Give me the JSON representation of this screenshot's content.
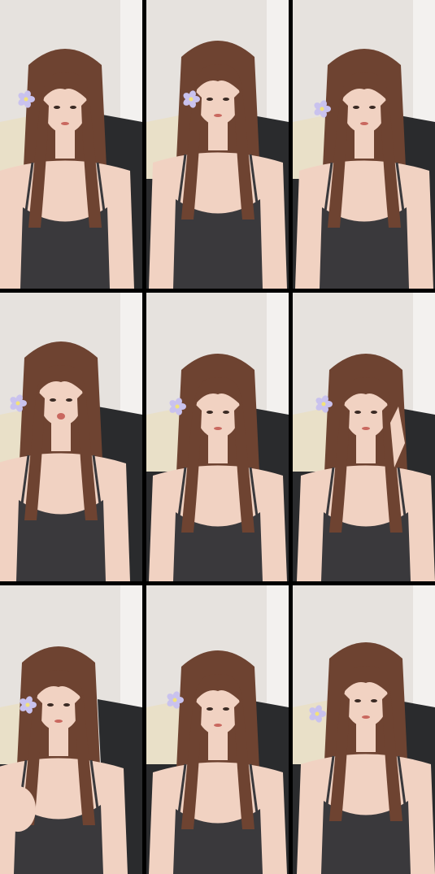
{
  "grid": {
    "rows": 3,
    "cols": 3,
    "frame_count": 9
  },
  "colors": {
    "wall": "#e6e2de",
    "sofa": "#2a2b2d",
    "cushion": "#e9e0c8",
    "skin": "#f1d2c2",
    "hair": "#6e4331",
    "tank_top": "#3a393c",
    "flower": "#c9c2ee",
    "flower_center": "#f2e27a",
    "divider": "#000000"
  },
  "frames": [
    {
      "name": "frame-1",
      "pose": "head-tilted-left"
    },
    {
      "name": "frame-2",
      "pose": "centered"
    },
    {
      "name": "frame-3",
      "pose": "centered-smile"
    },
    {
      "name": "frame-4",
      "pose": "mouth-open"
    },
    {
      "name": "frame-5",
      "pose": "neutral"
    },
    {
      "name": "frame-6",
      "pose": "hand-on-cheek"
    },
    {
      "name": "frame-7",
      "pose": "hands-raised"
    },
    {
      "name": "frame-8",
      "pose": "neutral"
    },
    {
      "name": "frame-9",
      "pose": "smile"
    }
  ]
}
